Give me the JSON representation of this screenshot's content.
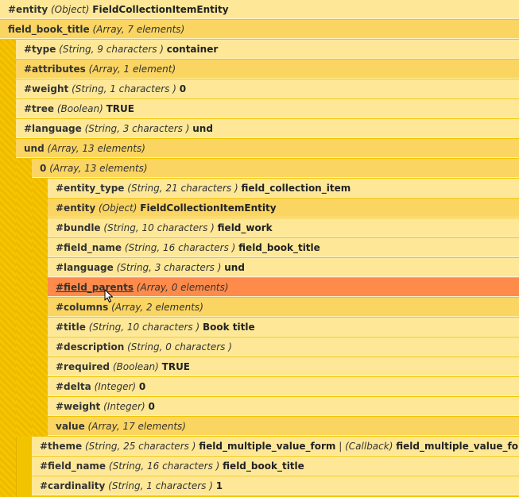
{
  "rows": [
    {
      "key": "#entity",
      "type": "(Object)",
      "value": "FieldCollectionItemEntity"
    },
    {
      "key": "field_book_title",
      "type": "(Array, 7 elements)",
      "value": ""
    },
    {
      "key": "#type",
      "type": "(String, 9 characters )",
      "value": "container"
    },
    {
      "key": "#attributes",
      "type": "(Array, 1 element)",
      "value": ""
    },
    {
      "key": "#weight",
      "type": "(String, 1 characters )",
      "value": "0"
    },
    {
      "key": "#tree",
      "type": "(Boolean)",
      "value": "TRUE"
    },
    {
      "key": "#language",
      "type": "(String, 3 characters )",
      "value": "und"
    },
    {
      "key": "und",
      "type": "(Array, 13 elements)",
      "value": ""
    },
    {
      "key": "0",
      "type": "(Array, 13 elements)",
      "value": ""
    },
    {
      "key": "#entity_type",
      "type": "(String, 21 characters )",
      "value": "field_collection_item"
    },
    {
      "key": "#entity",
      "type": "(Object)",
      "value": "FieldCollectionItemEntity"
    },
    {
      "key": "#bundle",
      "type": "(String, 10 characters )",
      "value": "field_work"
    },
    {
      "key": "#field_name",
      "type": "(String, 16 characters )",
      "value": "field_book_title"
    },
    {
      "key": "#language",
      "type": "(String, 3 characters )",
      "value": "und"
    },
    {
      "key": "#field_parents",
      "type": "(Array, 0 elements)",
      "value": ""
    },
    {
      "key": "#columns",
      "type": "(Array, 2 elements)",
      "value": ""
    },
    {
      "key": "#title",
      "type": "(String, 10 characters )",
      "value": "Book title"
    },
    {
      "key": "#description",
      "type": "(String, 0 characters )",
      "value": ""
    },
    {
      "key": "#required",
      "type": "(Boolean)",
      "value": "TRUE"
    },
    {
      "key": "#delta",
      "type": "(Integer)",
      "value": "0"
    },
    {
      "key": "#weight",
      "type": "(Integer)",
      "value": "0"
    },
    {
      "key": "value",
      "type": "(Array, 17 elements)",
      "value": ""
    },
    {
      "key": "#theme",
      "type": "(String, 25 characters )",
      "value": "field_multiple_value_form",
      "separator": "|",
      "type2": "(Callback)",
      "value2": "field_multiple_value_form();"
    },
    {
      "key": "#field_name",
      "type": "(String, 16 characters )",
      "value": "field_book_title"
    },
    {
      "key": "#cardinality",
      "type": "(String, 1 characters )",
      "value": "1"
    }
  ],
  "icons": {
    "cursor": "mouse-pointer-icon"
  },
  "colors": {
    "light_row": "#fee897",
    "dark_row": "#fbd561",
    "hover_row": "#ff8b4b",
    "rail": "#f7c500"
  }
}
